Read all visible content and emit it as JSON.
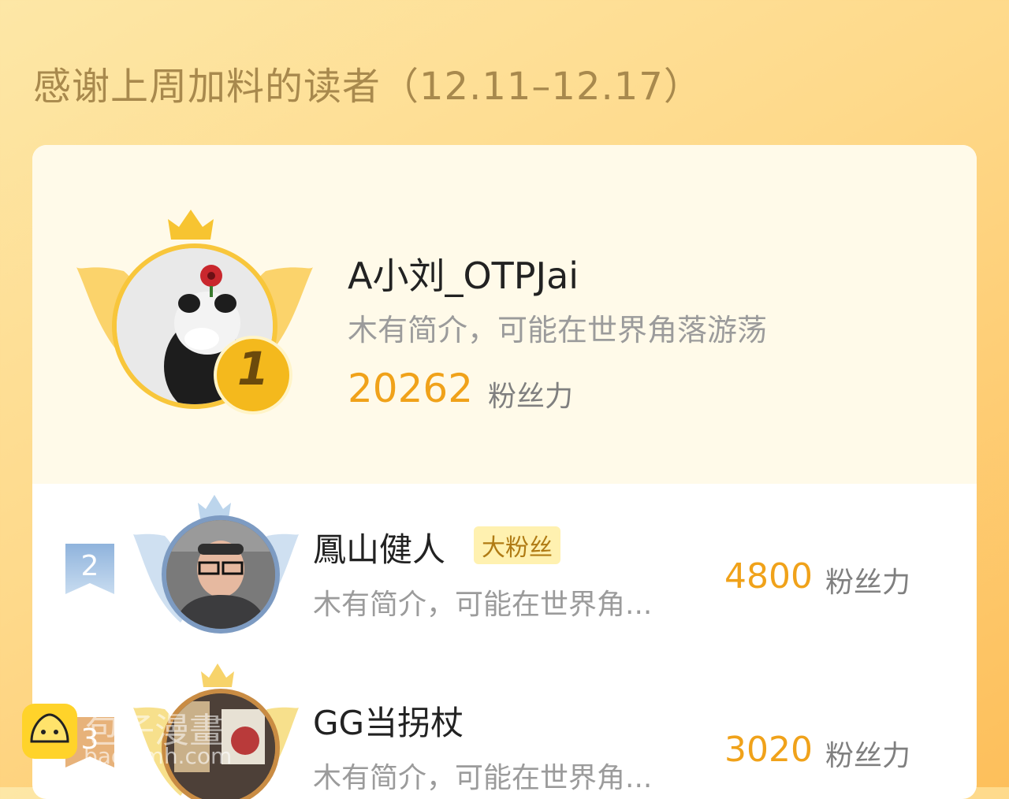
{
  "title": "感谢上周加料的读者（12.11–12.17）",
  "colors": {
    "accent": "#f0a21a",
    "gold": "#ffd44a",
    "silver": "#a9c6e2"
  },
  "readers": [
    {
      "rank": "1",
      "name": "A小刘_OTPJai",
      "bio": "木有简介，可能在世界角落游荡",
      "score": "20262",
      "unit": "粉丝力"
    },
    {
      "rank": "2",
      "name": "鳳山健人",
      "badge": "大粉丝",
      "bio": "木有简介，可能在世界角...",
      "score": "4800",
      "unit": "粉丝力"
    },
    {
      "rank": "3",
      "name": "GG当拐杖",
      "bio": "木有简介，可能在世界角...",
      "score": "3020",
      "unit": "粉丝力"
    }
  ],
  "watermark": {
    "text": "包子漫畫",
    "url": "baozimh.com",
    "icon": "bun-mascot-icon"
  }
}
